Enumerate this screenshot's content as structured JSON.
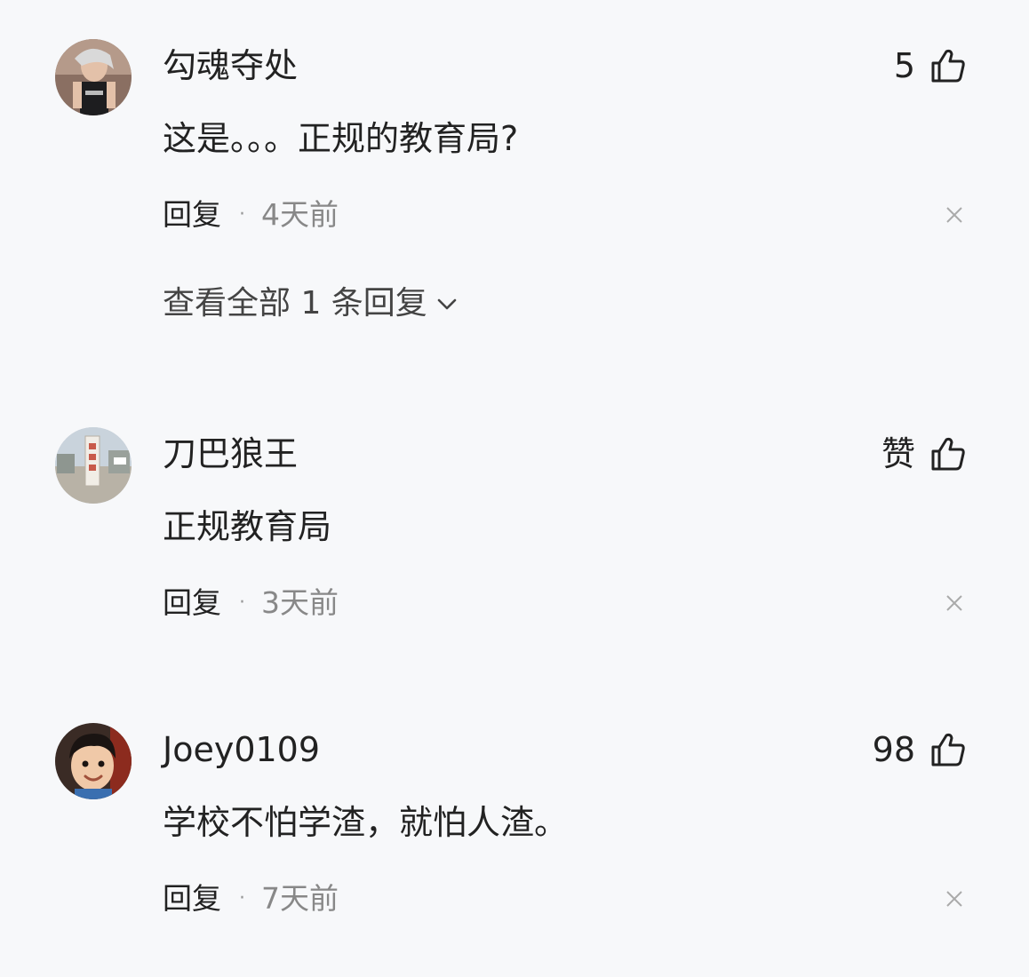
{
  "comments": [
    {
      "username": "勾魂夺处",
      "like_count": "5",
      "text": "这是。。。正规的教育局?",
      "reply_label": "回复",
      "separator": "·",
      "time": "4天前",
      "view_replies": "查看全部 1 条回复",
      "avatar_icon": "avatar-woman-photo"
    },
    {
      "username": "刀巴狼王",
      "like_count": "赞",
      "text": "正规教育局",
      "reply_label": "回复",
      "separator": "·",
      "time": "3天前",
      "avatar_icon": "avatar-monument-photo"
    },
    {
      "username": "Joey0109",
      "like_count": "98",
      "text": "学校不怕学渣，就怕人渣。",
      "reply_label": "回复",
      "separator": "·",
      "time": "7天前",
      "avatar_icon": "avatar-child-photo"
    }
  ],
  "icons": {
    "like": "thumbs-up-icon",
    "close": "close-icon",
    "expand": "chevron-down-icon"
  },
  "colors": {
    "background": "#f7f8fa",
    "text_primary": "#222222",
    "text_secondary": "#888888"
  }
}
